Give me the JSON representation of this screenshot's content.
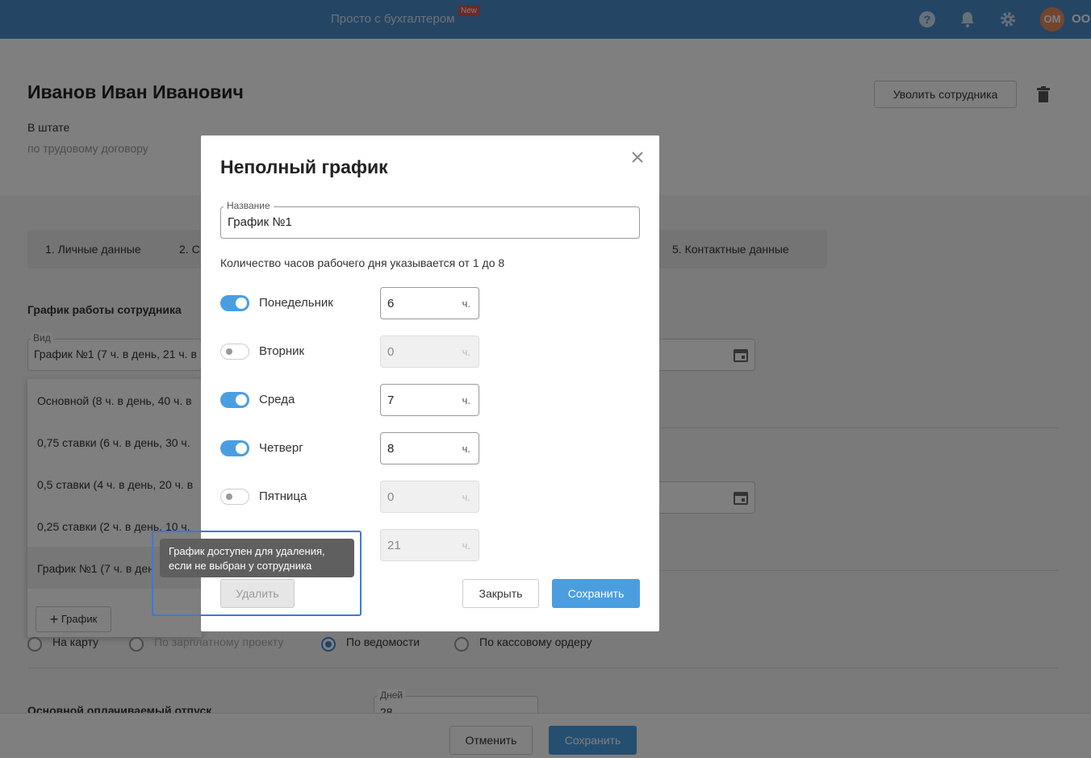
{
  "topbar": {
    "center_title": "Просто с бухгалтером",
    "new_badge": "New",
    "avatar_initials": "ОМ",
    "org_name": "ООО"
  },
  "employee": {
    "name": "Иванов Иван Иванович",
    "status": "В штате",
    "contract": "по трудовому договору",
    "fire_button": "Уволить сотрудника"
  },
  "tabs": [
    "1. Личные данные",
    "2. С",
    "5. Контактные данные"
  ],
  "schedule_section": {
    "title": "График работы сотрудника",
    "field_label": "Вид",
    "field_value": "График №1 (7 ч. в день, 21 ч. в"
  },
  "dropdown": {
    "items": [
      "Основной (8 ч. в день, 40 ч. в",
      "0,75 ставки (6 ч. в день, 30 ч.",
      "0,5 ставки (4 ч. в день, 20 ч. в",
      "0,25 ставки (2 ч. в день, 10 ч.",
      "График №1 (7 ч. в ден"
    ],
    "add_button": "График"
  },
  "payment": {
    "options": [
      "На карту",
      "По зарплатному проекту",
      "По ведомости",
      "По кассовому ордеру"
    ],
    "selected_index": 2
  },
  "vacation": {
    "title": "Основной оплачиваемый отпуск",
    "days_label": "Дней",
    "days_value": "28"
  },
  "bottom": {
    "cancel": "Отменить",
    "save": "Сохранить"
  },
  "modal": {
    "title": "Неполный график",
    "name_label": "Название",
    "name_value": "График №1",
    "hint": "Количество часов рабочего дня указывается от 1 до 8",
    "unit": "ч.",
    "days": [
      {
        "label": "Понедельник",
        "enabled": true,
        "hours": "6"
      },
      {
        "label": "Вторник",
        "enabled": false,
        "hours": "0"
      },
      {
        "label": "Среда",
        "enabled": true,
        "hours": "7"
      },
      {
        "label": "Четверг",
        "enabled": true,
        "hours": "8"
      },
      {
        "label": "Пятница",
        "enabled": false,
        "hours": "0"
      }
    ],
    "total_hours": "21",
    "tooltip_line1": "График доступен для удаления,",
    "tooltip_line2": "если не выбран у сотрудника",
    "delete_button": "Удалить",
    "close_button": "Закрыть",
    "save_button": "Сохранить"
  },
  "colors": {
    "topbar": "#4a8ac9",
    "accent": "#4a9ee0",
    "highlight": "#3a7bd5"
  }
}
